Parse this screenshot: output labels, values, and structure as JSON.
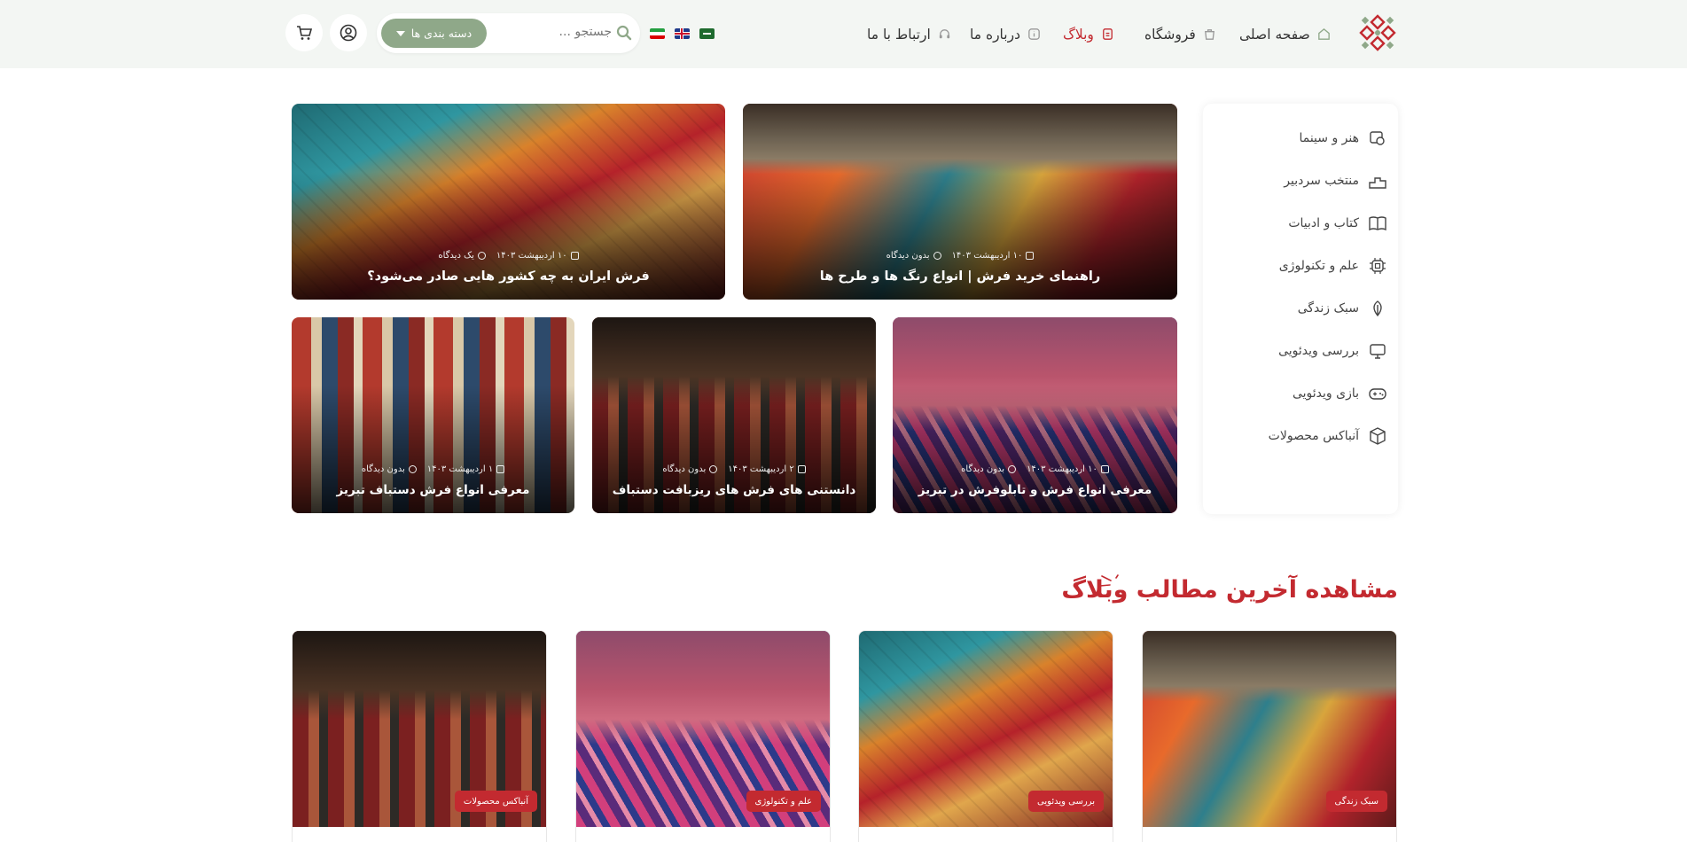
{
  "brand_color": "#c32a30",
  "accent_color": "#8fa889",
  "header": {
    "nav": [
      {
        "label": "صفحه اصلی",
        "icon": "home-icon",
        "active": false
      },
      {
        "label": "فروشگاه",
        "icon": "shopping-bag-icon",
        "active": false
      },
      {
        "label": "وبلاگ",
        "icon": "blog-icon",
        "active": true
      },
      {
        "label": "درباره ما",
        "icon": "info-icon",
        "active": false
      },
      {
        "label": "ارتباط با ما",
        "icon": "headset-icon",
        "active": false
      }
    ],
    "languages": [
      "fa-flag",
      "en-flag",
      "ar-flag"
    ],
    "search_placeholder": "جستجو ...",
    "category_button": "دسته بندی ها",
    "user_icon": "user-circle-icon",
    "cart_icon": "cart-icon"
  },
  "sidebar": {
    "items": [
      {
        "label": "هنر و سینما",
        "icon": "film-icon"
      },
      {
        "label": "منتخب سردبیر",
        "icon": "podium-icon"
      },
      {
        "label": "کتاب و ادبیات",
        "icon": "book-icon"
      },
      {
        "label": "علم و تکنولوژی",
        "icon": "chip-icon"
      },
      {
        "label": "سبک زندگی",
        "icon": "leaf-icon"
      },
      {
        "label": "بررسی ویدئویی",
        "icon": "monitor-icon"
      },
      {
        "label": "بازی ویدئویی",
        "icon": "gamepad-icon"
      },
      {
        "label": "آنباکس محصولات",
        "icon": "box-icon"
      }
    ]
  },
  "featured": [
    {
      "title": "راهنمای خرید فرش | انواع رنگ ها و طرح ها",
      "date": "۱۰ اردیبهشت ۱۴۰۳",
      "comments": "بدون دیدگاه"
    },
    {
      "title": "فرش ایران به چه کشور هایی صادر می‌شود؟",
      "date": "۱۰ اردیبهشت ۱۴۰۳",
      "comments": "یک دیدگاه"
    },
    {
      "title": "معرفی انواع فرش و تابلوفرش در تبریز",
      "date": "۱۰ اردیبهشت ۱۴۰۳",
      "comments": "بدون دیدگاه"
    },
    {
      "title": "دانستنی های فرش های ریزبافت دستباف",
      "date": "۲ اردیبهشت ۱۴۰۳",
      "comments": "بدون دیدگاه"
    },
    {
      "title": "معرفی انواع فرش دستباف تبریز",
      "date": "۱ اردیبهشت ۱۴۰۳",
      "comments": "بدون دیدگاه"
    }
  ],
  "latest": {
    "title": "مشاهده آخرین مطالب وبلاگ",
    "cards": [
      {
        "tag": "سبک زندگی"
      },
      {
        "tag": "بررسی ویدئویی"
      },
      {
        "tag": "علم و تکنولوژی"
      },
      {
        "tag": "آنباکس محصولات"
      }
    ]
  }
}
